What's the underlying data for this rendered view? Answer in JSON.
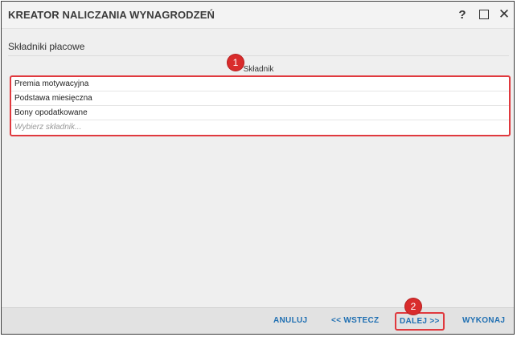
{
  "window": {
    "title": "KREATOR NALICZANIA WYNAGRODZEŃ",
    "help_icon": "?",
    "close_icon": "✕"
  },
  "section": {
    "title": "Składniki płacowe",
    "column_header": "Składnik"
  },
  "items": [
    {
      "label": "Premia motywacyjna"
    },
    {
      "label": "Podstawa miesięczna"
    },
    {
      "label": "Bony opodatkowane"
    }
  ],
  "selector": {
    "placeholder": "Wybierz składnik..."
  },
  "callouts": {
    "first": "1",
    "second": "2"
  },
  "footer": {
    "cancel": "ANULUJ",
    "back": "<< WSTECZ",
    "next": "DALEJ >>",
    "run": "WYKONAJ"
  },
  "colors": {
    "accent_link": "#1f6fb2",
    "highlight": "#e0393e",
    "callout": "#d92c2c"
  }
}
